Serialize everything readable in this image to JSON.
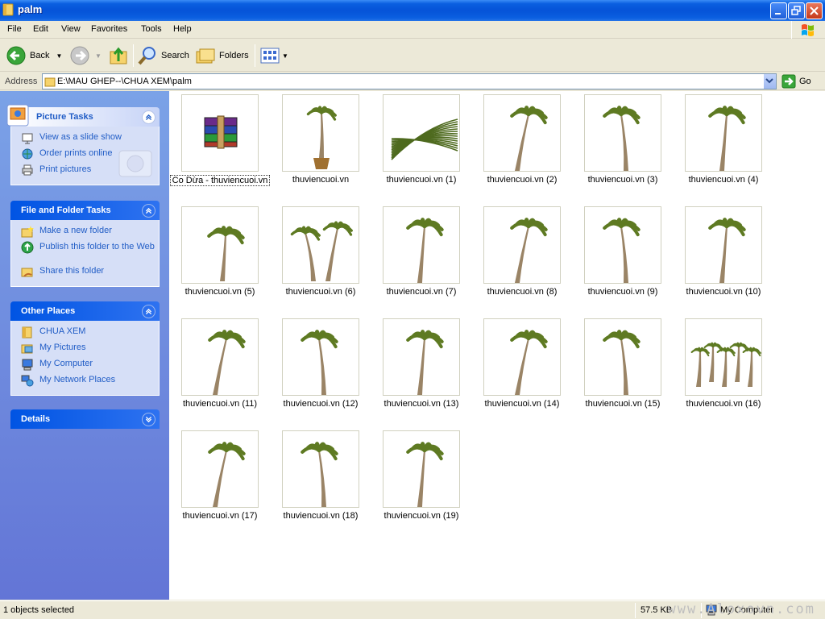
{
  "window": {
    "title": "palm"
  },
  "menu": [
    "File",
    "Edit",
    "View",
    "Favorites",
    "Tools",
    "Help"
  ],
  "toolbar": {
    "back": "Back",
    "search": "Search",
    "folders": "Folders"
  },
  "address": {
    "label": "Address",
    "path": "E:\\MAU GHEP--\\CHUA XEM\\palm",
    "go": "Go"
  },
  "sidebar": {
    "picture_tasks": {
      "title": "Picture Tasks",
      "items": [
        "View as a slide show",
        "Order prints online",
        "Print pictures"
      ]
    },
    "file_tasks": {
      "title": "File and Folder Tasks",
      "items": [
        "Make a new folder",
        "Publish this folder to the Web",
        "Share this folder"
      ]
    },
    "other_places": {
      "title": "Other Places",
      "items": [
        "CHUA XEM",
        "My Pictures",
        "My Computer",
        "My Network Places"
      ]
    },
    "details": {
      "title": "Details"
    }
  },
  "files": [
    "Co Dừa - thuviencuoi.vn",
    "thuviencuoi.vn",
    "thuviencuoi.vn (1)",
    "thuviencuoi.vn (2)",
    "thuviencuoi.vn (3)",
    "thuviencuoi.vn (4)",
    "thuviencuoi.vn (5)",
    "thuviencuoi.vn (6)",
    "thuviencuoi.vn (7)",
    "thuviencuoi.vn (8)",
    "thuviencuoi.vn (9)",
    "thuviencuoi.vn (10)",
    "thuviencuoi.vn (11)",
    "thuviencuoi.vn (12)",
    "thuviencuoi.vn (13)",
    "thuviencuoi.vn (14)",
    "thuviencuoi.vn (15)",
    "thuviencuoi.vn (16)",
    "thuviencuoi.vn (17)",
    "thuviencuoi.vn (18)",
    "thuviencuoi.vn (19)"
  ],
  "status": {
    "selection": "1 objects selected",
    "size": "57.5 KB",
    "zone": "My Computer",
    "watermark": "www.Aloxovn.com"
  },
  "colors": {
    "title_bar": "#0553d8",
    "task_text": "#215dc6",
    "pane_bg": "#7ba2e7"
  }
}
